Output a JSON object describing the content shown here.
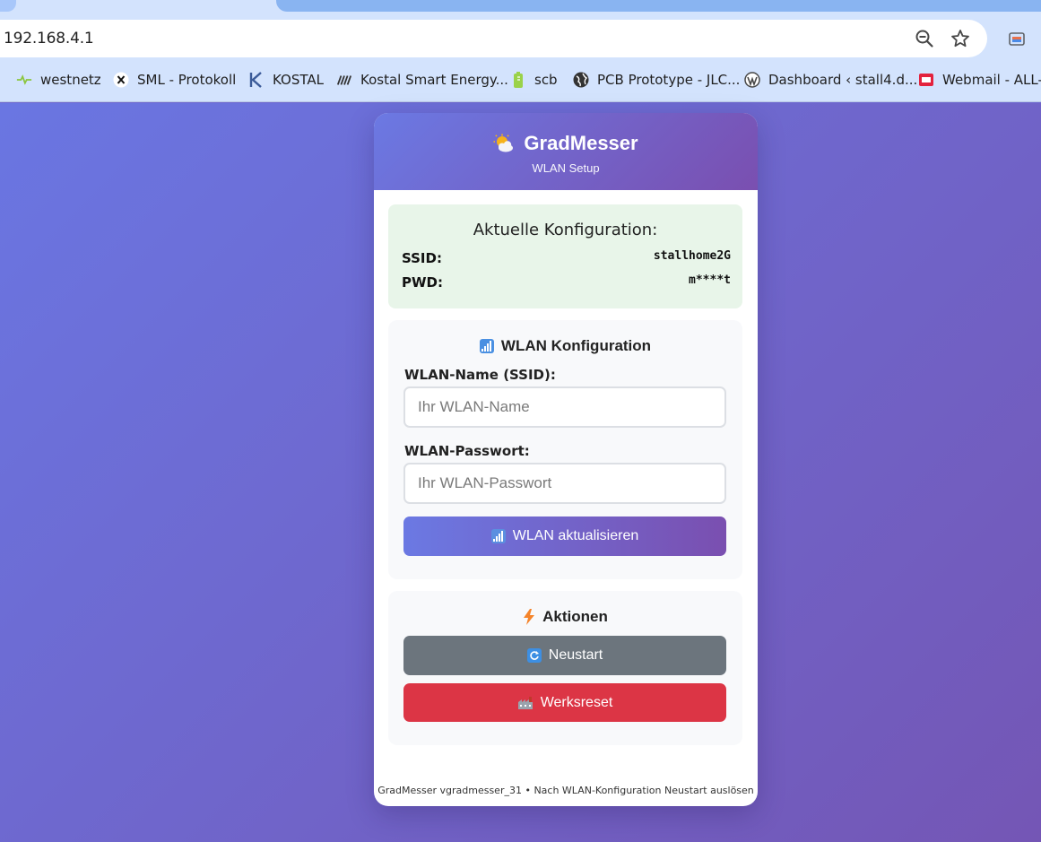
{
  "browser": {
    "url": "192.168.4.1",
    "bookmarks": [
      {
        "label": "westnetz",
        "icon": "westnetz-icon"
      },
      {
        "label": "SML - Protokoll",
        "icon": "x-icon"
      },
      {
        "label": "KOSTAL",
        "icon": "kostal-icon"
      },
      {
        "label": "Kostal Smart Energy...",
        "icon": "kostal-smart-energy-icon"
      },
      {
        "label": "scb",
        "icon": "battery-icon"
      },
      {
        "label": "PCB Prototype - JLC...",
        "icon": "globe-icon"
      },
      {
        "label": "Dashboard ‹ stall4.d...",
        "icon": "wordpress-icon"
      },
      {
        "label": "Webmail - ALL-IN",
        "icon": "webmail-icon"
      }
    ]
  },
  "header": {
    "title": "GradMesser",
    "subtitle": "WLAN Setup",
    "icon": "sun-cloud-icon"
  },
  "config": {
    "title": "Aktuelle Konfiguration:",
    "ssid_label": "SSID:",
    "ssid_value": "stallhome2G",
    "pwd_label": "PWD:",
    "pwd_value": "m****t"
  },
  "wlan": {
    "title": "WLAN Konfiguration",
    "ssid_label": "WLAN-Name (SSID):",
    "ssid_placeholder": "Ihr WLAN-Name",
    "pwd_label": "WLAN-Passwort:",
    "pwd_placeholder": "Ihr WLAN-Passwort",
    "submit_label": "WLAN aktualisieren"
  },
  "actions": {
    "title": "Aktionen",
    "restart_label": "Neustart",
    "reset_label": "Werksreset"
  },
  "footer": "GradMesser vgradmesser_31 • Nach WLAN-Konfiguration Neustart auslösen",
  "colors": {
    "accent_start": "#6b79e3",
    "accent_end": "#7a4fb0",
    "restart": "#6c757d",
    "reset": "#dc3545",
    "config_bg": "#e8f5e9"
  }
}
